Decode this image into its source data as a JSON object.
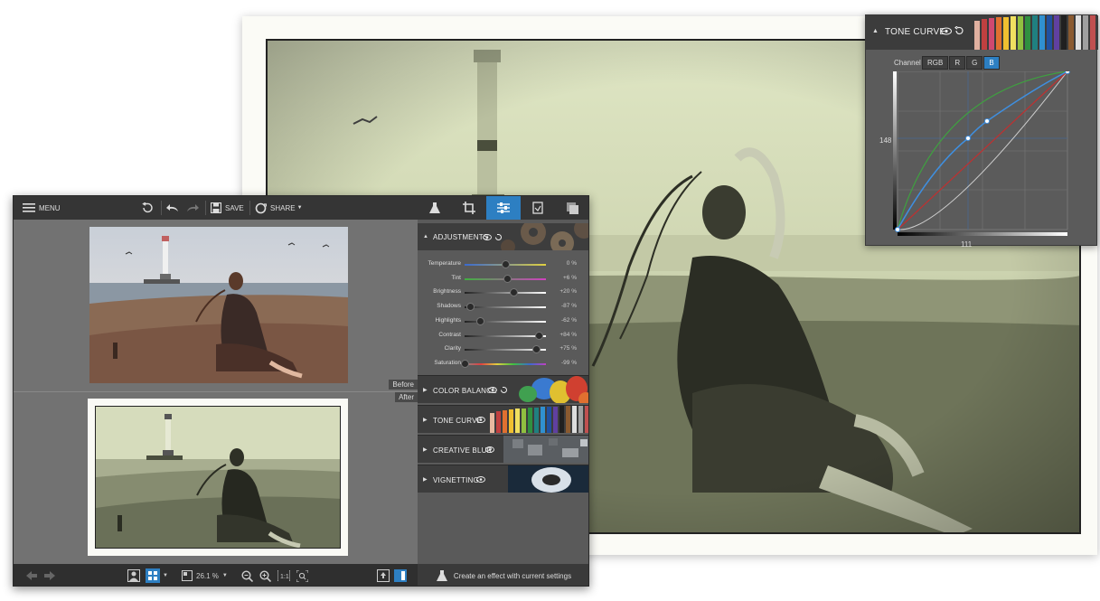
{
  "app": {
    "menu_label": "MENU",
    "save_label": "SAVE",
    "share_label": "SHARE",
    "before_label": "Before",
    "after_label": "After",
    "zoom_value": "26.1 %",
    "create_effect_label": "Create an effect with current settings"
  },
  "adjustments": {
    "title": "ADJUSTMENTS",
    "sliders": [
      {
        "label": "Temperature",
        "value": "0 %",
        "level": 0.5
      },
      {
        "label": "Tint",
        "value": "+6 %",
        "level": 0.53
      },
      {
        "label": "Brightness",
        "value": "+20 %",
        "level": 0.6
      },
      {
        "label": "Shadows",
        "value": "-87 %",
        "level": 0.07
      },
      {
        "label": "Highlights",
        "value": "-62 %",
        "level": 0.19
      },
      {
        "label": "Contrast",
        "value": "+84 %",
        "level": 0.92
      },
      {
        "label": "Clarity",
        "value": "+75 %",
        "level": 0.88
      },
      {
        "label": "Saturation",
        "value": "-99 %",
        "level": 0.0
      }
    ]
  },
  "sections": {
    "color_balance": "COLOR BALANCE",
    "tone_curve": "TONE CURVE",
    "creative_blur": "CREATIVE BLUR",
    "vignetting": "VIGNETTING"
  },
  "tone_curve_panel": {
    "title": "TONE CURVE",
    "channel_label": "Channel",
    "channels": [
      "RGB",
      "R",
      "G",
      "B"
    ],
    "active_channel": "B",
    "input_readout": "111",
    "output_readout": "148"
  },
  "colors": {
    "accent": "#2d7fc2",
    "panel_dark": "#353535",
    "sepia_tint": "#d8dfb8"
  }
}
